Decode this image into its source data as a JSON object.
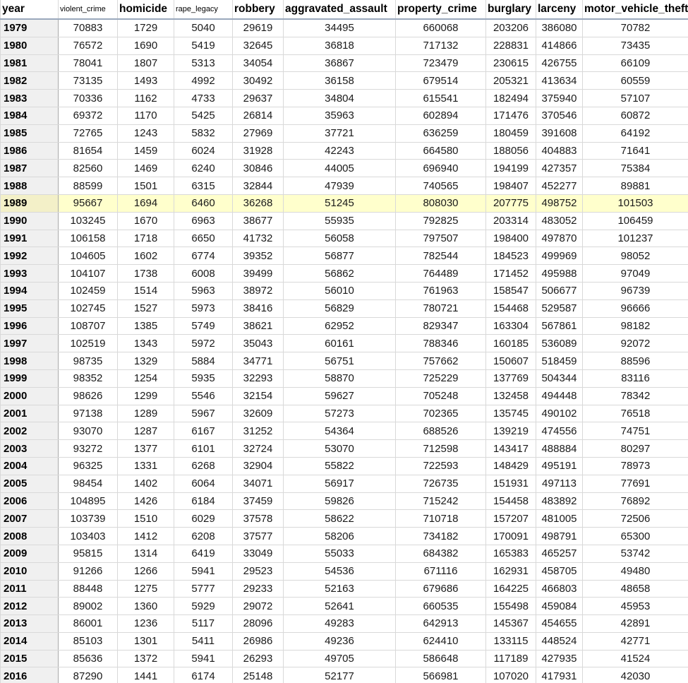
{
  "columns": [
    "year",
    "violent_crime",
    "homicide",
    "rape_legacy",
    "robbery",
    "aggravated_assault",
    "property_crime",
    "burglary",
    "larceny",
    "motor_vehicle_theft"
  ],
  "selected_year": "1989",
  "rows": [
    [
      "1979",
      "70883",
      "1729",
      "5040",
      "29619",
      "34495",
      "660068",
      "203206",
      "386080",
      "70782"
    ],
    [
      "1980",
      "76572",
      "1690",
      "5419",
      "32645",
      "36818",
      "717132",
      "228831",
      "414866",
      "73435"
    ],
    [
      "1981",
      "78041",
      "1807",
      "5313",
      "34054",
      "36867",
      "723479",
      "230615",
      "426755",
      "66109"
    ],
    [
      "1982",
      "73135",
      "1493",
      "4992",
      "30492",
      "36158",
      "679514",
      "205321",
      "413634",
      "60559"
    ],
    [
      "1983",
      "70336",
      "1162",
      "4733",
      "29637",
      "34804",
      "615541",
      "182494",
      "375940",
      "57107"
    ],
    [
      "1984",
      "69372",
      "1170",
      "5425",
      "26814",
      "35963",
      "602894",
      "171476",
      "370546",
      "60872"
    ],
    [
      "1985",
      "72765",
      "1243",
      "5832",
      "27969",
      "37721",
      "636259",
      "180459",
      "391608",
      "64192"
    ],
    [
      "1986",
      "81654",
      "1459",
      "6024",
      "31928",
      "42243",
      "664580",
      "188056",
      "404883",
      "71641"
    ],
    [
      "1987",
      "82560",
      "1469",
      "6240",
      "30846",
      "44005",
      "696940",
      "194199",
      "427357",
      "75384"
    ],
    [
      "1988",
      "88599",
      "1501",
      "6315",
      "32844",
      "47939",
      "740565",
      "198407",
      "452277",
      "89881"
    ],
    [
      "1989",
      "95667",
      "1694",
      "6460",
      "36268",
      "51245",
      "808030",
      "207775",
      "498752",
      "101503"
    ],
    [
      "1990",
      "103245",
      "1670",
      "6963",
      "38677",
      "55935",
      "792825",
      "203314",
      "483052",
      "106459"
    ],
    [
      "1991",
      "106158",
      "1718",
      "6650",
      "41732",
      "56058",
      "797507",
      "198400",
      "497870",
      "101237"
    ],
    [
      "1992",
      "104605",
      "1602",
      "6774",
      "39352",
      "56877",
      "782544",
      "184523",
      "499969",
      "98052"
    ],
    [
      "1993",
      "104107",
      "1738",
      "6008",
      "39499",
      "56862",
      "764489",
      "171452",
      "495988",
      "97049"
    ],
    [
      "1994",
      "102459",
      "1514",
      "5963",
      "38972",
      "56010",
      "761963",
      "158547",
      "506677",
      "96739"
    ],
    [
      "1995",
      "102745",
      "1527",
      "5973",
      "38416",
      "56829",
      "780721",
      "154468",
      "529587",
      "96666"
    ],
    [
      "1996",
      "108707",
      "1385",
      "5749",
      "38621",
      "62952",
      "829347",
      "163304",
      "567861",
      "98182"
    ],
    [
      "1997",
      "102519",
      "1343",
      "5972",
      "35043",
      "60161",
      "788346",
      "160185",
      "536089",
      "92072"
    ],
    [
      "1998",
      "98735",
      "1329",
      "5884",
      "34771",
      "56751",
      "757662",
      "150607",
      "518459",
      "88596"
    ],
    [
      "1999",
      "98352",
      "1254",
      "5935",
      "32293",
      "58870",
      "725229",
      "137769",
      "504344",
      "83116"
    ],
    [
      "2000",
      "98626",
      "1299",
      "5546",
      "32154",
      "59627",
      "705248",
      "132458",
      "494448",
      "78342"
    ],
    [
      "2001",
      "97138",
      "1289",
      "5967",
      "32609",
      "57273",
      "702365",
      "135745",
      "490102",
      "76518"
    ],
    [
      "2002",
      "93070",
      "1287",
      "6167",
      "31252",
      "54364",
      "688526",
      "139219",
      "474556",
      "74751"
    ],
    [
      "2003",
      "93272",
      "1377",
      "6101",
      "32724",
      "53070",
      "712598",
      "143417",
      "488884",
      "80297"
    ],
    [
      "2004",
      "96325",
      "1331",
      "6268",
      "32904",
      "55822",
      "722593",
      "148429",
      "495191",
      "78973"
    ],
    [
      "2005",
      "98454",
      "1402",
      "6064",
      "34071",
      "56917",
      "726735",
      "151931",
      "497113",
      "77691"
    ],
    [
      "2006",
      "104895",
      "1426",
      "6184",
      "37459",
      "59826",
      "715242",
      "154458",
      "483892",
      "76892"
    ],
    [
      "2007",
      "103739",
      "1510",
      "6029",
      "37578",
      "58622",
      "710718",
      "157207",
      "481005",
      "72506"
    ],
    [
      "2008",
      "103403",
      "1412",
      "6208",
      "37577",
      "58206",
      "734182",
      "170091",
      "498791",
      "65300"
    ],
    [
      "2009",
      "95815",
      "1314",
      "6419",
      "33049",
      "55033",
      "684382",
      "165383",
      "465257",
      "53742"
    ],
    [
      "2010",
      "91266",
      "1266",
      "5941",
      "29523",
      "54536",
      "671116",
      "162931",
      "458705",
      "49480"
    ],
    [
      "2011",
      "88448",
      "1275",
      "5777",
      "29233",
      "52163",
      "679686",
      "164225",
      "466803",
      "48658"
    ],
    [
      "2012",
      "89002",
      "1360",
      "5929",
      "29072",
      "52641",
      "660535",
      "155498",
      "459084",
      "45953"
    ],
    [
      "2013",
      "86001",
      "1236",
      "5117",
      "28096",
      "49283",
      "642913",
      "145367",
      "454655",
      "42891"
    ],
    [
      "2014",
      "85103",
      "1301",
      "5411",
      "26986",
      "49236",
      "624410",
      "133115",
      "448524",
      "42771"
    ],
    [
      "2015",
      "85636",
      "1372",
      "5941",
      "26293",
      "49705",
      "586648",
      "117189",
      "427935",
      "41524"
    ],
    [
      "2016",
      "87290",
      "1441",
      "6174",
      "25148",
      "52177",
      "566981",
      "107020",
      "417931",
      "42030"
    ]
  ]
}
